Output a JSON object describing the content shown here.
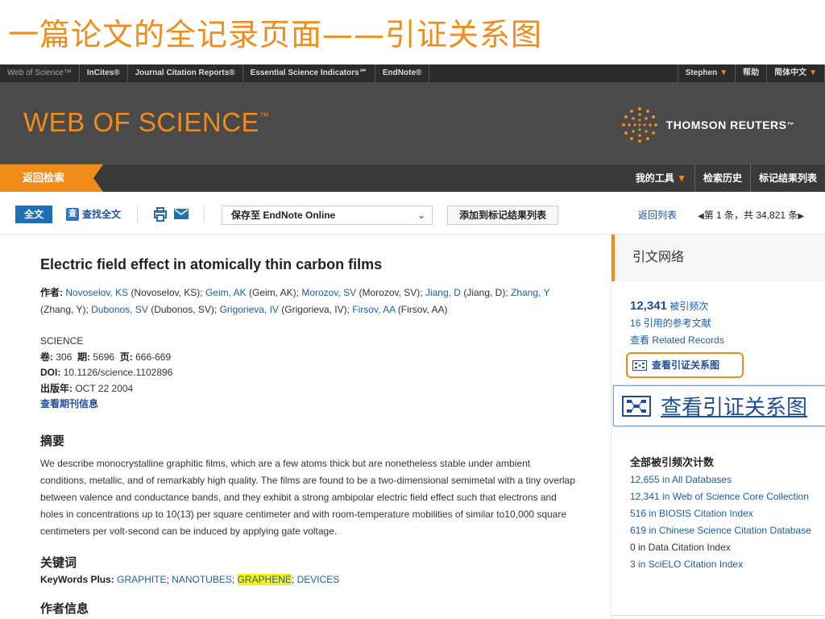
{
  "slide_title": "一篇论文的全记录页面——引证关系图",
  "topnav": {
    "brand": "Web of Science™",
    "items": [
      "InCites®",
      "Journal Citation Reports®",
      "Essential Science Indicators℠",
      "EndNote®"
    ],
    "user": "Stephen",
    "help": "帮助",
    "language": "简体中文"
  },
  "banner": {
    "logo": "WEB OF SCIENCE",
    "logo_mark": "™",
    "publisher": "THOMSON REUTERS",
    "publisher_mark": "™"
  },
  "subnav": {
    "back": "返回检索",
    "my_tools": "我的工具",
    "history": "检索历史",
    "marked_list": "标记结果列表"
  },
  "toolbar": {
    "full_text": "全文",
    "find_full_text": "查找全文",
    "find_full_text_icon": "查",
    "save_to": "保存至 EndNote Online",
    "add_to_list": "添加到标记结果列表",
    "return_list": "返回列表",
    "pager": "第 1 条，共 34,821 条"
  },
  "record": {
    "title": "Electric field effect in atomically thin carbon films",
    "author_label": "作者:",
    "authors": [
      {
        "name": "Novoselov, KS",
        "full": " (Novoselov, KS); "
      },
      {
        "name": "Geim, AK",
        "full": " (Geim, AK); "
      },
      {
        "name": "Morozov, SV",
        "full": " (Morozov, SV); "
      },
      {
        "name": "Jiang, D",
        "full": " (Jiang, D); "
      },
      {
        "name": "Zhang, Y",
        "full": " (Zhang, Y); "
      },
      {
        "name": "Dubonos, SV",
        "full": " (Dubonos, SV); "
      },
      {
        "name": "Grigorieva, IV",
        "full": " (Grigorieva, IV); "
      },
      {
        "name": "Firsov, AA",
        "full": " (Firsov, AA)"
      }
    ],
    "journal": "SCIENCE",
    "volume_label": "卷:",
    "volume": "306",
    "issue_label": "期:",
    "issue": "5696",
    "pages_label": "页:",
    "pages": "666-669",
    "doi_label": "DOI:",
    "doi": "10.1126/science.1102896",
    "pub_date_label": "出版年:",
    "pub_date": "OCT 22 2004",
    "journal_info": "查看期刊信息",
    "abstract_head": "摘要",
    "abstract": "We describe monocrystalline graphitic films, which are a few atoms thick but are nonetheless stable under ambient conditions, metallic, and of remarkably high quality. The films are found to be a two-dimensional semimetal with a tiny overlap between valence and conductance bands, and they exhibit a strong ambipolar electric field effect such that electrons and holes in concentrations up to 10(13) per square centimeter and with room-temperature mobilities of similar to10,000 square centimeters per volt-second can be induced by applying gate voltage.",
    "keywords_head": "关键词",
    "keywords_label": "KeyWords Plus:",
    "keywords": [
      "GRAPHITE",
      "NANOTUBES",
      "GRAPHENE",
      "DEVICES"
    ],
    "author_info_head": "作者信息"
  },
  "sidebar": {
    "title": "引文网络",
    "times_cited": "12,341",
    "times_cited_label": "被引频次",
    "references": "16 引用的参考文献",
    "related": "查看 Related Records",
    "citation_map": "查看引证关系图",
    "callout": "查看引证关系图",
    "counts_head": "全部被引频次计数",
    "counts": [
      "12,655 in All Databases",
      "12,341 in Web of Science Core Collection",
      "516 in BIOSIS Citation Index",
      "619 in Chinese Science Citation Database",
      "0 in Data Citation Index",
      "3 in SciELO Citation Index"
    ]
  },
  "colors": {
    "accent": "#f08c1a",
    "link": "#1f5ea8",
    "banner": "#4a4a4a",
    "highlight": "#fff200"
  }
}
